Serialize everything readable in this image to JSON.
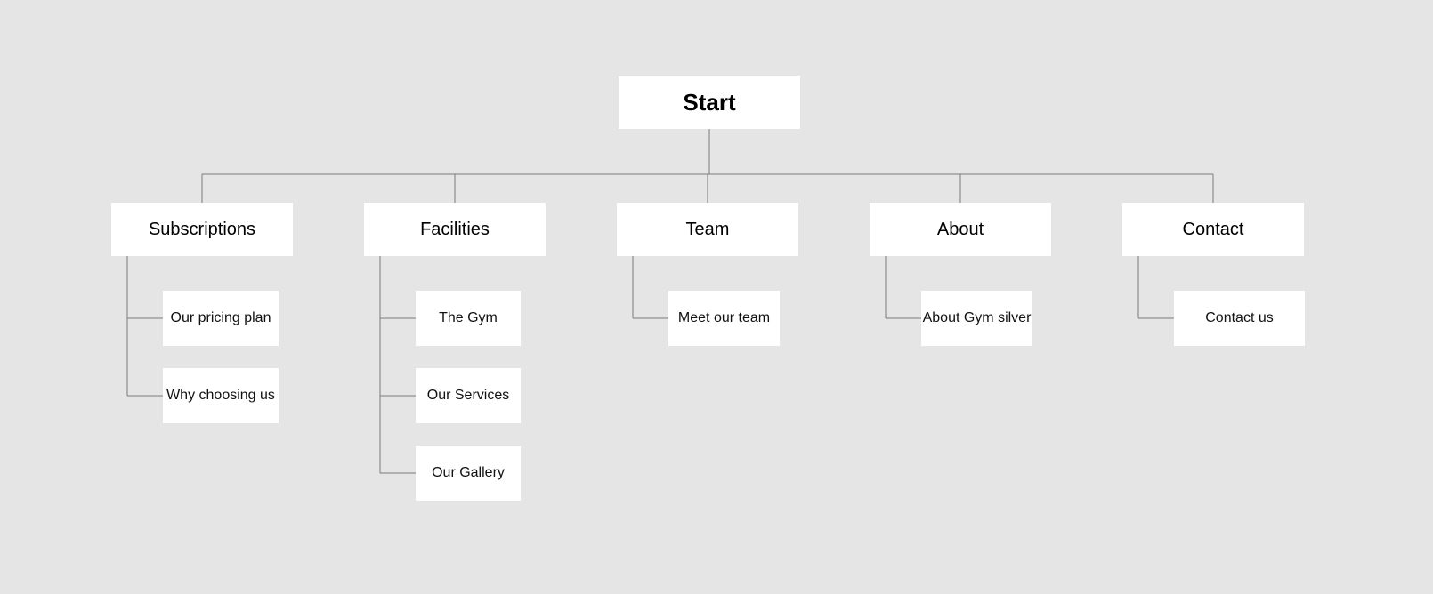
{
  "root": {
    "label": "Start"
  },
  "sections": [
    {
      "label": "Subscriptions",
      "children": [
        {
          "label": "Our pricing plan"
        },
        {
          "label": "Why choosing us"
        }
      ]
    },
    {
      "label": "Facilities",
      "children": [
        {
          "label": "The Gym"
        },
        {
          "label": "Our Services"
        },
        {
          "label": "Our Gallery"
        }
      ]
    },
    {
      "label": "Team",
      "children": [
        {
          "label": "Meet our team"
        }
      ]
    },
    {
      "label": "About",
      "children": [
        {
          "label": "About Gym silver"
        }
      ]
    },
    {
      "label": "Contact",
      "children": [
        {
          "label": "Contact us"
        }
      ]
    }
  ],
  "colors": {
    "bg": "#e5e5e5",
    "node": "#ffffff",
    "line": "#7a7a7a"
  }
}
